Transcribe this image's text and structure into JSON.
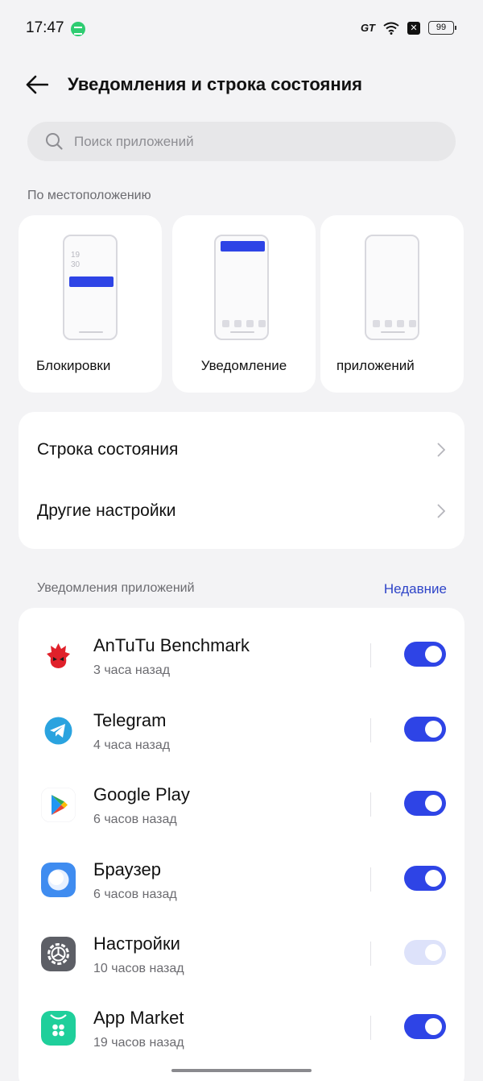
{
  "status_bar": {
    "time": "17:47",
    "battery": "99",
    "gt_label": "GT",
    "x_label": "✕"
  },
  "header": {
    "title": "Уведомления и строка состояния"
  },
  "search": {
    "placeholder": "Поиск приложений"
  },
  "location_section": {
    "title": "По местоположению",
    "cards": [
      {
        "label": "Блокировки",
        "lock_time": "19\n30"
      },
      {
        "label": "Уведомление"
      },
      {
        "label": "приложений"
      }
    ]
  },
  "settings": [
    {
      "label": "Строка состояния"
    },
    {
      "label": "Другие настройки"
    }
  ],
  "app_notifications": {
    "title": "Уведомления приложений",
    "sort_link": "Недавние",
    "apps": [
      {
        "name": "AnTuTu Benchmark",
        "time": "3 часа назад",
        "icon": "antutu-icon",
        "enabled": true
      },
      {
        "name": "Telegram",
        "time": "4 часа назад",
        "icon": "telegram-icon",
        "enabled": true
      },
      {
        "name": "Google Play",
        "time": "6 часов назад",
        "icon": "google-play-icon",
        "enabled": true
      },
      {
        "name": "Браузер",
        "time": "6 часов назад",
        "icon": "browser-icon",
        "enabled": true
      },
      {
        "name": "Настройки",
        "time": "10 часов назад",
        "icon": "settings-gear-icon",
        "enabled": true,
        "locked": true
      },
      {
        "name": "App Market",
        "time": "19 часов назад",
        "icon": "app-market-icon",
        "enabled": true
      }
    ]
  },
  "colors": {
    "accent": "#2e44e6",
    "link": "#2e44c8",
    "background": "#f3f3f5"
  }
}
